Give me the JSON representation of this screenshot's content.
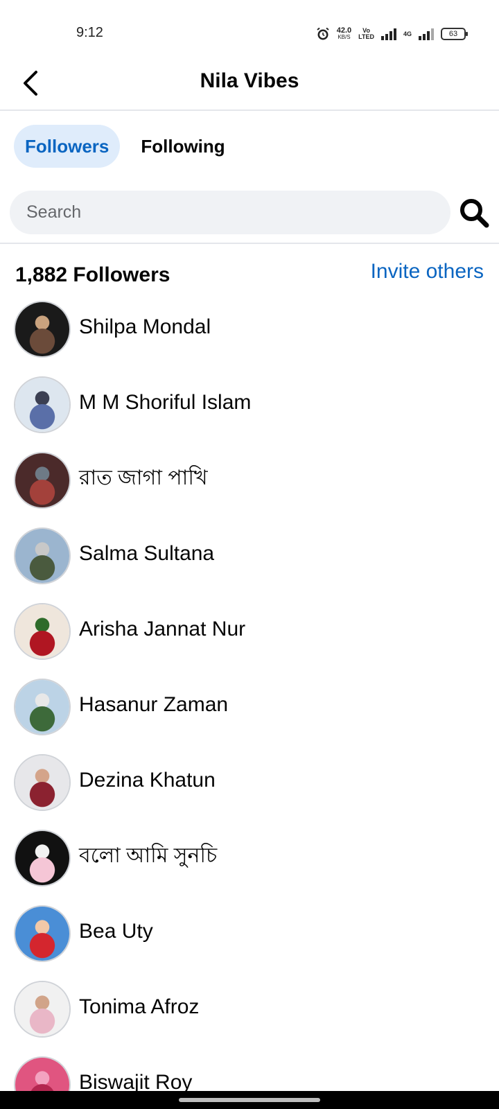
{
  "status_bar": {
    "time": "9:12",
    "net_speed": "42.0",
    "net_unit": "KB/S",
    "volte": "Vo",
    "volte2": "LTED",
    "network": "4G",
    "battery": "63"
  },
  "header": {
    "title": "Nila Vibes"
  },
  "tabs": [
    {
      "label": "Followers",
      "active": true
    },
    {
      "label": "Following",
      "active": false
    }
  ],
  "search": {
    "placeholder": "Search",
    "value": ""
  },
  "summary": {
    "count_label": "1,882 Followers",
    "invite_label": "Invite others"
  },
  "followers": [
    {
      "name": "Shilpa Mondal",
      "avatar_colors": [
        "#1a1a1a",
        "#6b4b3a",
        "#c9a27e"
      ]
    },
    {
      "name": "M M Shoriful Islam",
      "avatar_colors": [
        "#dde6ef",
        "#5a6fa8",
        "#3b3f52"
      ]
    },
    {
      "name": "রাত জাগা পাখি",
      "avatar_colors": [
        "#4b2a2a",
        "#a3413b",
        "#6e7a86"
      ]
    },
    {
      "name": "Salma Sultana",
      "avatar_colors": [
        "#9bb5cf",
        "#4a5a3e",
        "#c8c8c8"
      ]
    },
    {
      "name": "Arisha Jannat Nur",
      "avatar_colors": [
        "#efe6dc",
        "#b01622",
        "#2e6b2a"
      ]
    },
    {
      "name": "Hasanur Zaman",
      "avatar_colors": [
        "#bcd3e6",
        "#3d6a3a",
        "#e8e8e8"
      ]
    },
    {
      "name": "Dezina Khatun",
      "avatar_colors": [
        "#e7e7ea",
        "#8b2230",
        "#d4a48a"
      ]
    },
    {
      "name": "বলো আমি সুনচি",
      "avatar_colors": [
        "#111111",
        "#f5c6d6",
        "#f2f2f2"
      ]
    },
    {
      "name": "Bea Uty",
      "avatar_colors": [
        "#4a8ed6",
        "#d4262e",
        "#f3c9a8"
      ]
    },
    {
      "name": "Tonima Afroz",
      "avatar_colors": [
        "#f1f1f1",
        "#e9b7c7",
        "#d1a489"
      ]
    },
    {
      "name": "Biswajit Roy",
      "avatar_colors": [
        "#e05580",
        "#b3264f",
        "#f3a3c0"
      ]
    }
  ],
  "accent_color": "#0a65c1"
}
